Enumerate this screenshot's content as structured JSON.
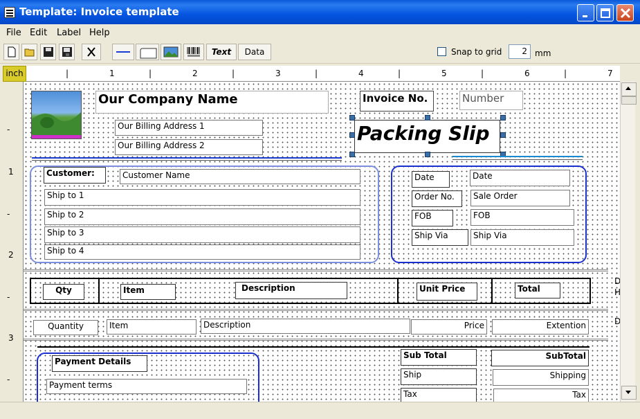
{
  "window": {
    "title": "Template: Invoice template"
  },
  "menu": [
    "File",
    "Edit",
    "Label",
    "Help"
  ],
  "toolbar": {
    "buttons": [
      "new-file",
      "open-folder",
      "save",
      "save-all",
      "delete",
      "line",
      "rectangle",
      "image",
      "barcode"
    ],
    "text_label": "Text",
    "data_label": "Data",
    "snap_label": "Snap to grid",
    "snap_checked": false,
    "grid_value": "2",
    "grid_unit": "mm"
  },
  "ruler": {
    "unit": "inch",
    "h_ticks": [
      "|",
      "1",
      "|",
      "2",
      "|",
      "3",
      "|",
      "4",
      "|",
      "5",
      "|",
      "6",
      "|",
      "7"
    ],
    "v_ticks": [
      "-",
      "1",
      "-",
      "2",
      "-",
      "3",
      "-"
    ]
  },
  "header": {
    "company_name": "Our Company Name",
    "billing_address_1": "Our Billing Address 1",
    "billing_address_2": "Our Billing Address 2",
    "invoice_no_label": "Invoice No.",
    "invoice_no_value": "Number",
    "doc_title": "Packing Slip"
  },
  "customer": {
    "label": "Customer:",
    "name": "Customer Name",
    "ship_to": [
      "Ship to 1",
      "Ship to 2",
      "Ship to 3",
      "Ship to 4"
    ]
  },
  "order_info": {
    "rows": [
      {
        "label": "Date",
        "value": "Date"
      },
      {
        "label": "Order No.",
        "value": "Sale Order"
      },
      {
        "label": "FOB",
        "value": "FOB"
      },
      {
        "label": "Ship Via",
        "value": "Ship Via"
      }
    ]
  },
  "table_header": [
    "Qty",
    "Item",
    "Description",
    "Unit Price",
    "Total"
  ],
  "table_row": [
    "Quantity",
    "Item",
    "Description",
    "Price",
    "Extention"
  ],
  "band_labels": [
    "D",
    "H",
    "D"
  ],
  "payment": {
    "label": "Payment Details",
    "terms": "Payment terms"
  },
  "totals": [
    {
      "label": "Sub Total",
      "value": "SubTotal"
    },
    {
      "label": "Ship",
      "value": "Shipping"
    },
    {
      "label": "Tax",
      "value": "Tax"
    }
  ],
  "colors": {
    "accent_blue": "#1a2fd0",
    "ruler_unit": "#d9cc2a",
    "titlebar": "#0554e0"
  }
}
